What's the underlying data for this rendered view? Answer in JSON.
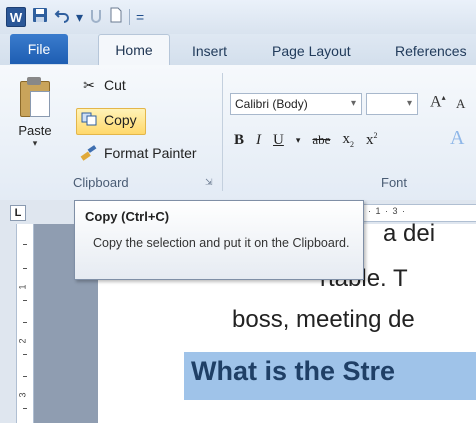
{
  "quick_access": {
    "app_icon": "W",
    "save_icon": "save-icon",
    "undo_icon": "undo-icon",
    "undo_dropdown": "▾",
    "redo_icon": "redo-icon",
    "new_icon": "new-document-icon",
    "customize": "="
  },
  "tabs": {
    "file": "File",
    "home": "Home",
    "insert": "Insert",
    "page_layout": "Page Layout",
    "references": "References"
  },
  "clipboard_group": {
    "paste": "Paste",
    "cut": "Cut",
    "copy": "Copy",
    "format_painter": "Format Painter",
    "label": "Clipboard"
  },
  "font_group": {
    "font_name": "Calibri (Body)",
    "font_size": "",
    "grow": "A",
    "shrink": "A",
    "bold": "B",
    "italic": "I",
    "underline": "U",
    "strikethrough": "abe",
    "subscript": "x",
    "superscript": "x",
    "clear": "A",
    "label": "Font"
  },
  "ruler": {
    "corner": "L",
    "h_marks": "· 1 · 3 ·",
    "v_marks": [
      "1",
      "2",
      "3"
    ]
  },
  "tooltip": {
    "title": "Copy (Ctrl+C)",
    "body": "Copy the selection and put it on the Clipboard."
  },
  "document": {
    "line1": "a  dei",
    "line2": "rtable. T",
    "line3": "boss, meeting de",
    "heading": "What is the Stre"
  },
  "colors": {
    "accent": "#1e5eb2",
    "selection": "#9fc3e9",
    "copy_highlight": "#ffd86b"
  }
}
